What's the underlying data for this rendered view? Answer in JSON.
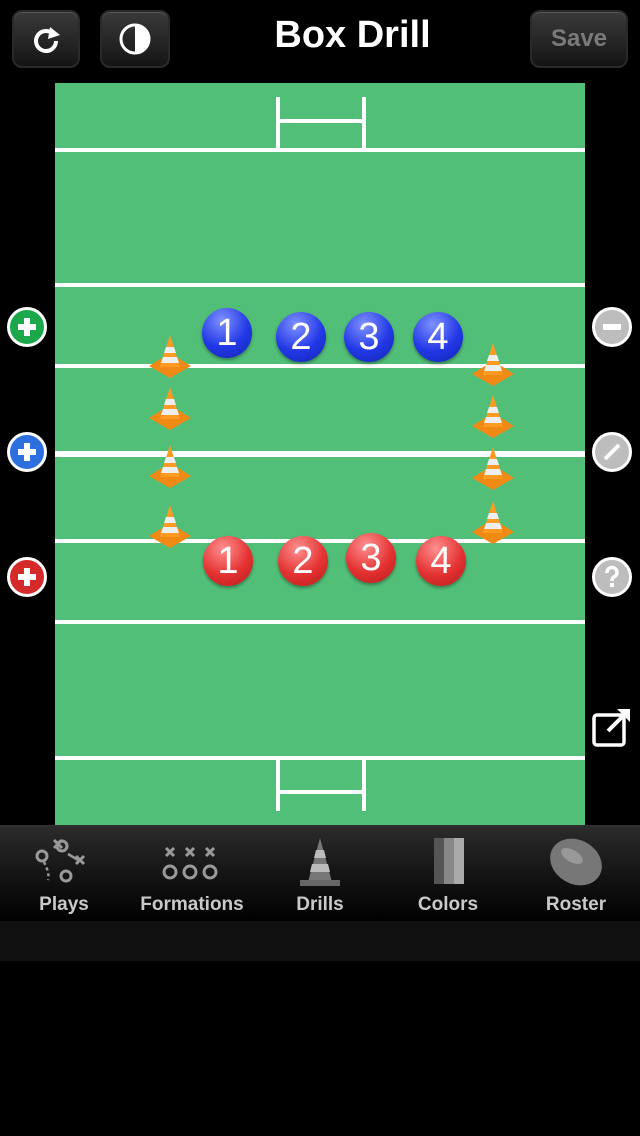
{
  "header": {
    "title": "Box Drill",
    "save_label": "Save"
  },
  "players": {
    "blue": [
      "1",
      "2",
      "3",
      "4"
    ],
    "red": [
      "1",
      "2",
      "3",
      "4"
    ]
  },
  "tabs": [
    {
      "label": "Plays",
      "icon": "plays-icon"
    },
    {
      "label": "Formations",
      "icon": "formations-icon"
    },
    {
      "label": "Drills",
      "icon": "cone-icon"
    },
    {
      "label": "Colors",
      "icon": "colors-icon"
    },
    {
      "label": "Roster",
      "icon": "ball-icon"
    }
  ],
  "colors": {
    "field": "#52bf79",
    "blue_team": "#2238e6",
    "red_team": "#e43232",
    "add_green": "#1aa84a"
  }
}
